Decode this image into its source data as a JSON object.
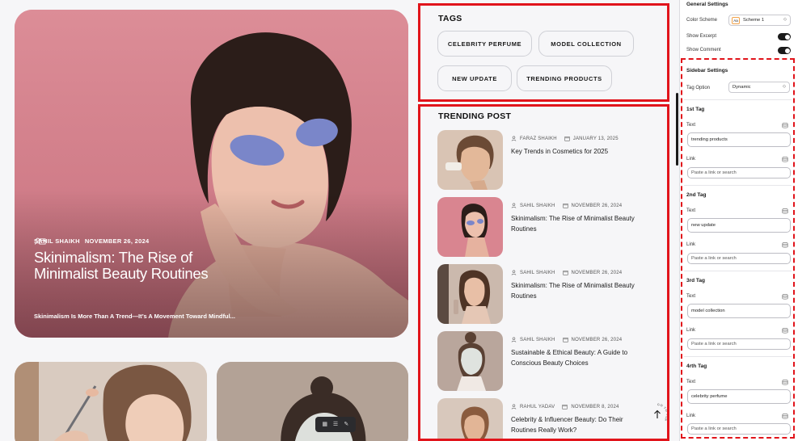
{
  "hero": {
    "author": "SAHIL SHAIKH",
    "date": "NOVEMBER 26, 2024",
    "title": "Skinimalism: The Rise of Minimalist Beauty Routines",
    "excerpt": "Skinimalism Is More Than A Trend—It’s A Movement Toward Mindful..."
  },
  "tags": {
    "title": "TAGS",
    "items": [
      "CELEBRITY PERFUME",
      "MODEL COLLECTION",
      "NEW UPDATE",
      "TRENDING PRODUCTS"
    ]
  },
  "trending": {
    "title": "TRENDING POST",
    "posts": [
      {
        "author": "FARAZ SHAIKH",
        "date": "JANUARY 13, 2025",
        "title": "Key Trends in Cosmetics for 2025"
      },
      {
        "author": "SAHIL SHAIKH",
        "date": "NOVEMBER 26, 2024",
        "title": "Skinimalism: The Rise of Minimalist Beauty Routines"
      },
      {
        "author": "SAHIL SHAIKH",
        "date": "NOVEMBER 26, 2024",
        "title": "Skinimalism: The Rise of Minimalist Beauty Routines"
      },
      {
        "author": "SAHIL SHAIKH",
        "date": "NOVEMBER 26, 2024",
        "title": "Sustainable & Ethical Beauty: A Guide to Conscious Beauty Choices"
      },
      {
        "author": "RAHUL YADAV",
        "date": "NOVEMBER 8, 2024",
        "title": "Celebrity & Influencer Beauty: Do Their Routines Really Work?"
      }
    ],
    "back_to_top": "GO TO TOP"
  },
  "panel": {
    "general_heading": "General Settings",
    "color_scheme_label": "Color Scheme",
    "color_scheme_swatch": "Aa",
    "color_scheme_value": "Scheme 1",
    "show_excerpt_label": "Show Excerpt",
    "show_excerpt_on": true,
    "show_comment_label": "Show Comment",
    "show_comment_on": true,
    "sidebar_heading": "Sidebar Settings",
    "tag_option_label": "Tag Option",
    "tag_option_value": "Dynamic",
    "tag_groups": [
      {
        "heading": "1st Tag",
        "text_label": "Text",
        "text_value": "trending products",
        "link_label": "Link",
        "link_placeholder": "Paste a link or search"
      },
      {
        "heading": "2nd Tag",
        "text_label": "Text",
        "text_value": "new update",
        "link_label": "Link",
        "link_placeholder": "Paste a link or search"
      },
      {
        "heading": "3rd Tag",
        "text_label": "Text",
        "text_value": "model collection",
        "link_label": "Link",
        "link_placeholder": "Paste a link or search"
      },
      {
        "heading": "4rth Tag",
        "text_label": "Text",
        "text_value": "celebrity perfume",
        "link_label": "Link",
        "link_placeholder": "Paste a link or search"
      }
    ]
  },
  "colors": {
    "highlight": "#e1141b",
    "hero_bg": "#d6848f",
    "toggle_on": "#1a1a1a"
  }
}
